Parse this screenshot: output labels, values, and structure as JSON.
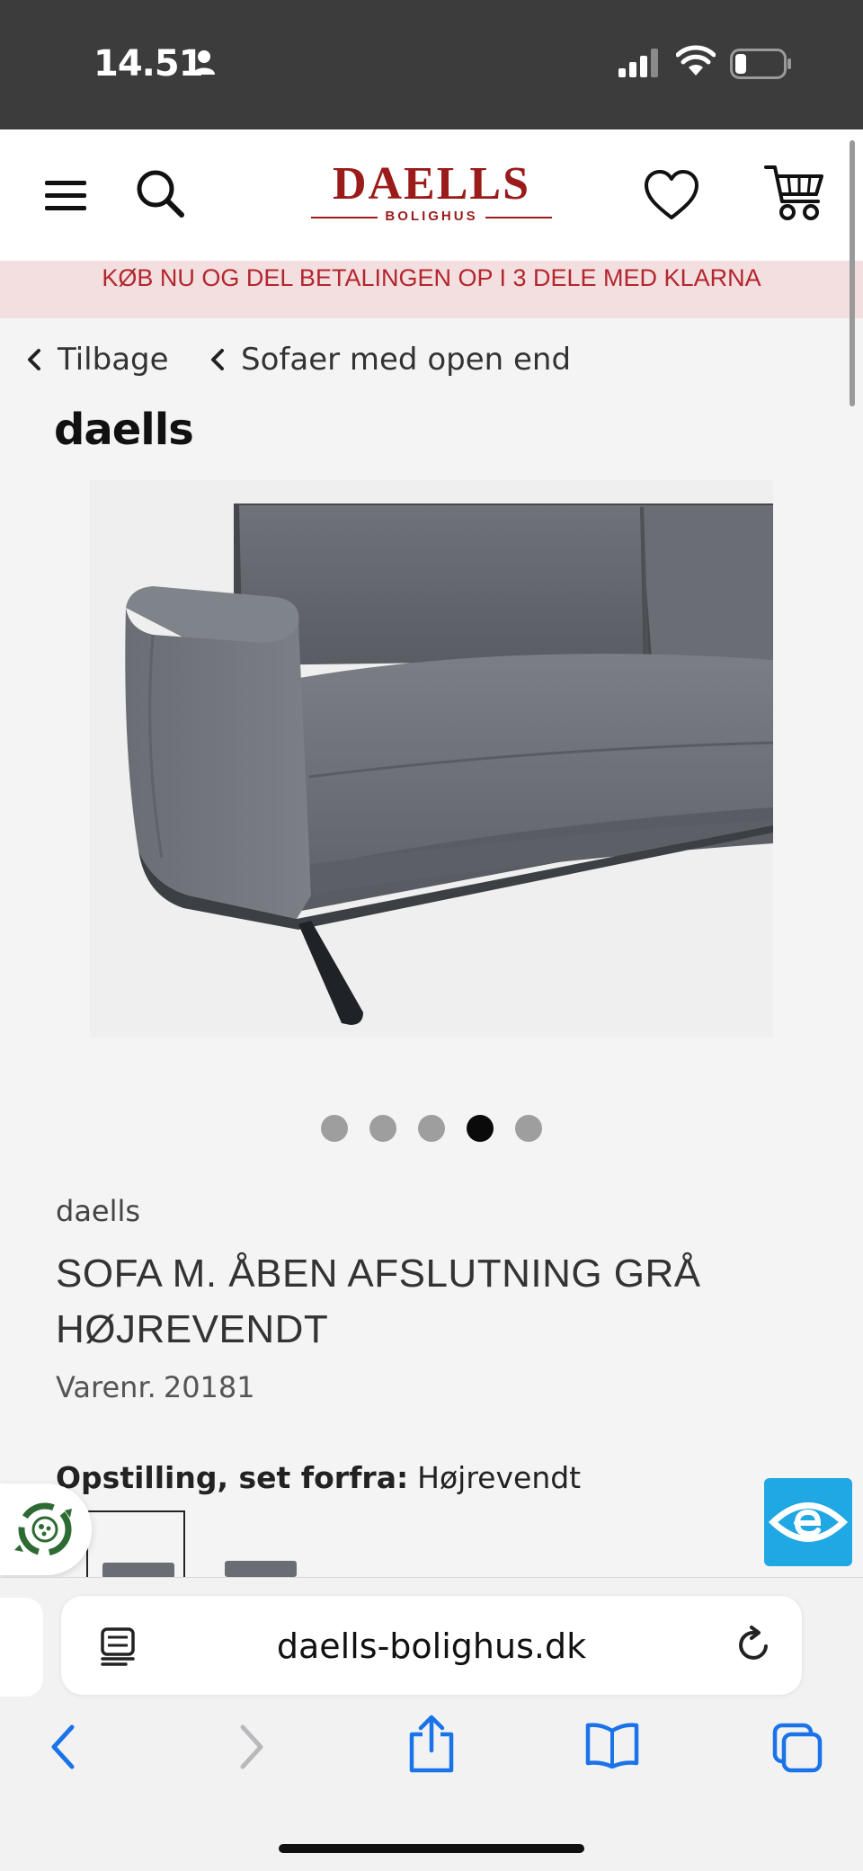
{
  "status_bar": {
    "time": "14.51"
  },
  "header": {
    "logo_brand": "DAELLS",
    "logo_sub": "BOLIGHUS"
  },
  "promo_banner": {
    "text": "KØB NU OG DEL BETALINGEN OP I 3 DELE MED KLARNA"
  },
  "breadcrumb": {
    "back_label": "Tilbage",
    "category_label": "Sofaer med open end"
  },
  "brand": "daells",
  "gallery": {
    "slide_count": 5,
    "active_index": 3
  },
  "product": {
    "vendor": "daells",
    "name": "SOFA M. ÅBEN AFSLUTNING GRÅ HØJREVENDT",
    "sku_label": "Varenr.",
    "sku": "20181",
    "option_label": "Opstilling, set forfra:",
    "option_value": "Højrevendt"
  },
  "browser": {
    "url": "daells-bolighus.dk"
  },
  "colors": {
    "brand_red": "#9b1b1b",
    "banner_bg": "#f3dfe0",
    "banner_text": "#b3262d",
    "safari_blue": "#1a73e8",
    "eye_badge": "#20a8e4",
    "eco_green": "#2e6b34"
  },
  "icons": {
    "menu": "hamburger-icon",
    "search": "search-icon",
    "wishlist": "heart-icon",
    "cart": "cart-icon",
    "back": "chevron-left-icon",
    "reader": "reader-mode-icon",
    "reload": "reload-icon",
    "share": "share-icon",
    "bookmarks": "book-icon",
    "tabs": "tabs-icon",
    "accessibility": "eye-icon",
    "eco": "recycle-icon"
  }
}
